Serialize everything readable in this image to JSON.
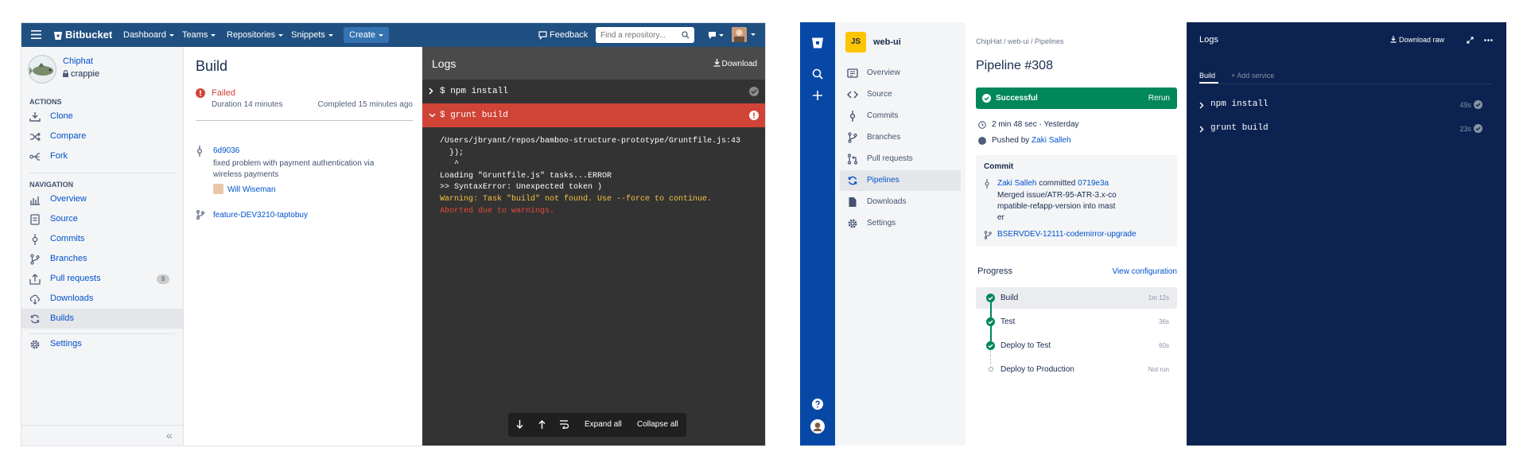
{
  "old_ui": {
    "topbar": {
      "logo": "Bitbucket",
      "menu": [
        "Dashboard",
        "Teams",
        "Repositories",
        "Snippets"
      ],
      "create": "Create",
      "feedback": "Feedback",
      "search_placeholder": "Find a repository..."
    },
    "sidebar": {
      "repo_owner": "Chiphat",
      "repo_name": "crappie",
      "actions_heading": "ACTIONS",
      "actions": [
        "Clone",
        "Compare",
        "Fork"
      ],
      "navigation_heading": "NAVIGATION",
      "nav": [
        "Overview",
        "Source",
        "Commits",
        "Branches",
        "Pull requests",
        "Downloads",
        "Builds"
      ],
      "pr_count": "9",
      "settings": "Settings",
      "collapse": "«"
    },
    "build": {
      "title": "Build",
      "status": "Failed",
      "duration": "Duration 14 minutes",
      "completed": "Completed 15 minutes ago",
      "commit_hash": "6d9036",
      "commit_message": "fixed problem with payment authentication via wireless payments",
      "author": "Will Wiseman",
      "branch": "feature-DEV3210-taptobuy"
    },
    "logs": {
      "title": "Logs",
      "download": "Download",
      "step1": "$ npm install",
      "step2": "$ grunt build",
      "output": [
        "/Users/jbryant/repos/bamboo-structure-prototype/Gruntfile.js:43",
        "  });",
        "   ^",
        "Loading \"Gruntfile.js\" tasks...ERROR",
        ">> SyntaxError: Unexpected token )"
      ],
      "warning": "Warning: Task \"build\" not found. Use --force to continue.",
      "aborted": "Aborted due to warnings.",
      "expand_all": "Expand all",
      "collapse_all": "Collapse all"
    }
  },
  "new_ui": {
    "repo": {
      "avatar_text": "JS",
      "name": "web-ui"
    },
    "nav": [
      "Overview",
      "Source",
      "Commits",
      "Branches",
      "Pull requests",
      "Pipelines",
      "Downloads",
      "Settings"
    ],
    "breadcrumb": "ChipHat / web-ui / Pipelines",
    "title": "Pipeline #308",
    "status": "Successful",
    "rerun": "Rerun",
    "duration": "2 min 48 sec",
    "dot": "·",
    "when": "Yesterday",
    "pushed_by_label": "Pushed by",
    "pushed_by": "Zaki Salleh",
    "commit": {
      "heading": "Commit",
      "author": "Zaki Salleh",
      "verb": "committed",
      "hash": "0719e3a",
      "message": "Merged issue/ATR-95-ATR-3.x-compatible-refapp-version into master",
      "branch": "BSERVDEV-12111-codemirror-upgrade"
    },
    "progress": {
      "heading": "Progress",
      "view_config": "View configuration",
      "steps": [
        {
          "name": "Build",
          "time": "1m 12s"
        },
        {
          "name": "Test",
          "time": "36s"
        },
        {
          "name": "Deploy to Test",
          "time": "60s"
        },
        {
          "name": "Deploy to Production",
          "time": "Not run"
        }
      ]
    },
    "logs": {
      "title": "Logs",
      "download_raw": "Download raw",
      "tab_build": "Build",
      "tab_add": "+ Add service",
      "steps": [
        {
          "cmd": "npm install",
          "time": "49s"
        },
        {
          "cmd": "grunt build",
          "time": "23s"
        }
      ]
    },
    "colors": {
      "success": "#00875a",
      "brand": "#0747a6",
      "logs_bg": "#0c2351",
      "failed": "#de350b"
    }
  }
}
